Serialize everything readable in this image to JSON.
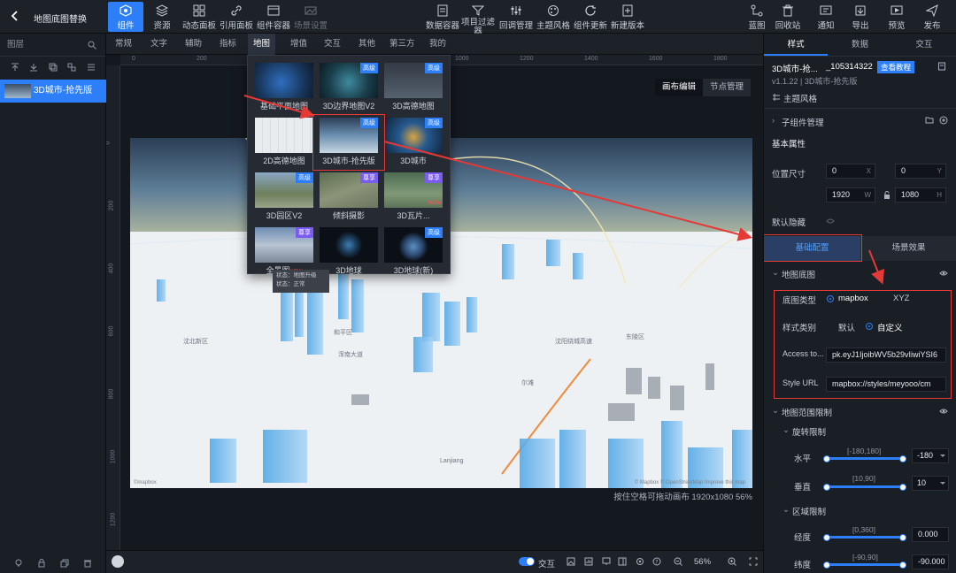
{
  "topbar": {
    "back_icon": "chevron-left-icon",
    "title": "地图底图替换",
    "buttons": [
      {
        "label": "组件",
        "icon": "component-icon",
        "active": true
      },
      {
        "label": "资源",
        "icon": "layers-icon"
      },
      {
        "label": "动态面板",
        "icon": "dashboard-icon"
      },
      {
        "label": "引用面板",
        "icon": "link-icon"
      },
      {
        "label": "组件容器",
        "icon": "container-icon"
      },
      {
        "label": "场景设置",
        "icon": "scene-icon",
        "disabled": true
      }
    ],
    "center_buttons": [
      {
        "label": "数据容器",
        "icon": "data-container-icon"
      },
      {
        "label": "项目过滤器",
        "icon": "filter-icon"
      },
      {
        "label": "回调管理",
        "icon": "callback-icon"
      },
      {
        "label": "主题风格",
        "icon": "theme-icon"
      },
      {
        "label": "组件更新",
        "icon": "refresh-icon"
      },
      {
        "label": "新建版本",
        "icon": "new-version-icon"
      }
    ],
    "right_buttons": [
      {
        "label": "蓝图",
        "icon": "blueprint-icon"
      },
      {
        "label": "回收站",
        "icon": "trash-icon"
      },
      {
        "label": "通知",
        "icon": "bell-icon"
      },
      {
        "label": "导出",
        "icon": "export-icon"
      },
      {
        "label": "预览",
        "icon": "preview-icon"
      },
      {
        "label": "发布",
        "icon": "publish-icon"
      }
    ]
  },
  "left_panel": {
    "header": "图层",
    "layer_item": "3D城市-抢先版"
  },
  "category_tabs": [
    "常规",
    "文字",
    "辅助",
    "指标",
    "地图",
    "增值",
    "交互",
    "其他",
    "第三方",
    "我的"
  ],
  "active_tab": "地图",
  "ruler": {
    "h_ticks": [
      "0",
      "200",
      "400",
      "600",
      "800",
      "1000",
      "1200",
      "1400",
      "1600",
      "1800"
    ],
    "v_ticks": [
      "0",
      "200",
      "400",
      "600",
      "800",
      "1000",
      "1200"
    ]
  },
  "view_toggle": [
    "画布编辑",
    "节点管理"
  ],
  "map_labels": {
    "district1": "和平区",
    "district2": "东陵区",
    "district3": "沈北新区",
    "road1": "沈阳绕城高速",
    "road2": "浑南大道",
    "place1": "尔滩",
    "place2": "Lanjiang",
    "credit_left": "©mapbox",
    "credit_right": "© Mapbox © OpenStreetMap Improve this map"
  },
  "dropdown": {
    "items": [
      {
        "label": "基础平面地图",
        "badge": ""
      },
      {
        "label": "3D边界地图V2",
        "badge": "高级"
      },
      {
        "label": "3D高德地图",
        "badge": "高级"
      },
      {
        "label": "2D高德地图",
        "badge": ""
      },
      {
        "label": "3D城市-抢先版",
        "badge": "高级"
      },
      {
        "label": "3D城市",
        "badge": "高级"
      },
      {
        "label": "3D园区V2",
        "badge": "高级"
      },
      {
        "label": "倾斜摄影",
        "badge": "尊享"
      },
      {
        "label": "3D瓦片...",
        "badge": "尊享"
      },
      {
        "label": "全景图",
        "badge": "尊享"
      },
      {
        "label": "3D地球",
        "badge": ""
      },
      {
        "label": "3D地球(新)",
        "badge": "高级"
      }
    ],
    "new_tag": "NEW",
    "tooltip_line1": "状态：地图升级",
    "tooltip_line2": "状态：正常"
  },
  "canvas_status": "按住空格可拖动画布   1920x1080 56%",
  "bottombar": {
    "interaction_label": "交互",
    "zoom": "56%"
  },
  "right_panel": {
    "tabs": [
      "样式",
      "数据",
      "交互"
    ],
    "component_name": "3D城市-抢...",
    "component_id": "_105314322",
    "tutorial_link": "查看教程",
    "version": "v1.1.22 | 3D城市-抢先版",
    "theme_style": "主题风格",
    "child_manage": "子组件管理",
    "basic_props": "基本属性",
    "pos_size_label": "位置尺寸",
    "x": "0",
    "y": "0",
    "w": "1920",
    "h": "1080",
    "default_hidden": "默认隐藏",
    "sub_tabs": [
      "基础配置",
      "场景效果"
    ],
    "basemap_section": "地图底图",
    "basemap_type_label": "底图类型",
    "basemap_type_options": [
      "mapbox",
      "XYZ"
    ],
    "style_category_label": "样式类别",
    "style_category_options": [
      "默认",
      "自定义"
    ],
    "access_token_label": "Access to...",
    "access_token_value": "pk.eyJ1IjoibWV5b29vIiwiYSI6",
    "style_url_label": "Style URL",
    "style_url_value": "mapbox://styles/meyooo/cm",
    "range_section": "地图范围限制",
    "rotation_section": "旋转限制",
    "horizontal_label": "水平",
    "horizontal_range": "[-180,180]",
    "horizontal_value": "-180",
    "vertical_label": "垂直",
    "vertical_range": "[10,90]",
    "vertical_value": "10",
    "region_section": "区域限制",
    "lng_label": "经度",
    "lng_range": "[0,360]",
    "lng_value": "0.000",
    "lat_label": "纬度",
    "lat_range": "[-90,90]",
    "lat_value": "-90.000"
  },
  "colors": {
    "accent": "#2d7ff9",
    "annotation": "#e53935",
    "panel": "#1a1e25"
  }
}
